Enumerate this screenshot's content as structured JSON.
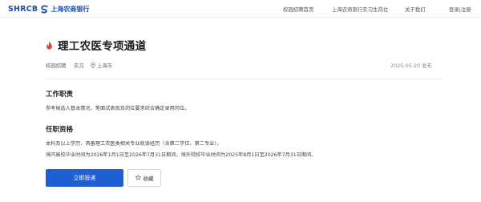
{
  "header": {
    "logo_en": "SHRCB",
    "logo_cn": "上海农商银行",
    "nav": [
      "校园招聘首页",
      "上海农商银行实习生岗位",
      "关于我们",
      "登录|注册"
    ],
    "brand_color": "#1f4fa5"
  },
  "job": {
    "title": "理工农医专项通道",
    "title_icon": "flame-icon",
    "tags": [
      "校园招聘",
      "实习"
    ],
    "location": "上海市",
    "date": "2025-05-20 发布"
  },
  "sections": {
    "duties_title": "工作职责",
    "duties_text": "参考候选人基本情况、笔面试表现及岗位要求综合确定录用岗位。",
    "req_title": "任职资格",
    "req_text_1": "本科及以上学历，具备理工农医类相关专业就读经历（含第二学位、第二专业）。",
    "req_text_2": "境内高校毕业时间为2026年1月1日至2026年7月31日期间，境外院校毕业时间为2025年8月1日至2026年7月31日期间。"
  },
  "actions": {
    "apply_label": "立即投递",
    "favorite_label": "收藏",
    "accent_color": "#1e5fd3"
  }
}
